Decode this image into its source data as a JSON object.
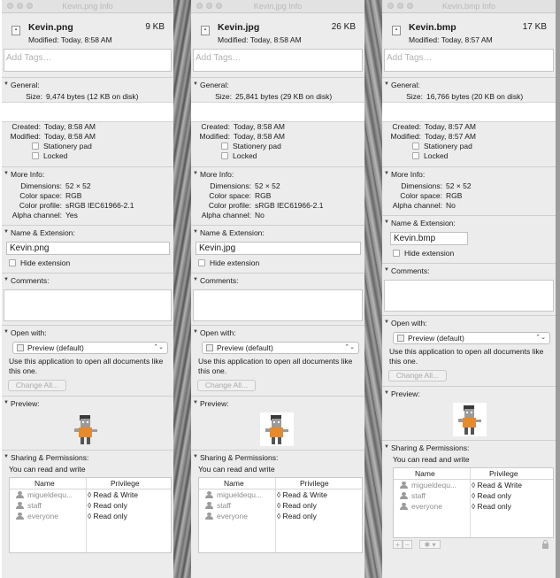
{
  "common": {
    "tags_placeholder": "Add Tags…",
    "sections": {
      "general": "General:",
      "more_info": "More Info:",
      "name_ext": "Name & Extension:",
      "comments": "Comments:",
      "open_with": "Open with:",
      "preview": "Preview:",
      "sharing": "Sharing & Permissions:"
    },
    "labels": {
      "size": "Size:",
      "created": "Created:",
      "modified": "Modified:",
      "stationery": "Stationery pad",
      "locked": "Locked",
      "dimensions": "Dimensions:",
      "color_space": "Color space:",
      "color_profile": "Color profile:",
      "alpha_channel": "Alpha channel:",
      "hide_extension": "Hide extension"
    },
    "open_with_app": "Preview (default)",
    "open_with_desc": "Use this application to open all documents like this one.",
    "change_all": "Change All...",
    "can_read_write": "You can read and write",
    "perm_headers": {
      "name": "Name",
      "privilege": "Privilege"
    },
    "perm_rows": [
      {
        "name": "migueldequ...",
        "privilege": "◊ Read & Write"
      },
      {
        "name": "staff",
        "privilege": "◊ Read only"
      },
      {
        "name": "everyone",
        "privilege": "◊ Read only"
      }
    ],
    "footer_buttons": {
      "add": "+",
      "remove": "−",
      "action": "✱ ▾"
    },
    "icons": {
      "file": "file-icon",
      "disclosure": "disclosure-triangle-icon",
      "app": "preview-app-icon",
      "user": "user-icon",
      "group": "group-icon",
      "lock": "lock-icon",
      "gear": "gear-icon"
    },
    "colors": {
      "window_bg": "#ececec",
      "desktop": "#7d7d7d"
    }
  },
  "windows": [
    {
      "title": "Kevin.png Info",
      "file_name": "Kevin.png",
      "file_size": "9 KB",
      "modified_line": "Modified: Today, 8:58 AM",
      "size_detail": "9,474 bytes (12 KB on disk)",
      "created": "Today, 8:58 AM",
      "modified": "Today, 8:58 AM",
      "dimensions": "52 × 52",
      "color_space": "RGB",
      "color_profile": "sRGB IEC61966-2.1",
      "alpha_channel": "Yes",
      "name_value": "Kevin.png",
      "preview_bg": "transparent"
    },
    {
      "title": "Kevin.jpg Info",
      "file_name": "Kevin.jpg",
      "file_size": "26 KB",
      "modified_line": "Modified: Today, 8:58 AM",
      "size_detail": "25,841 bytes (29 KB on disk)",
      "created": "Today, 8:58 AM",
      "modified": "Today, 8:58 AM",
      "dimensions": "52 × 52",
      "color_space": "RGB",
      "color_profile": "sRGB IEC61966-2.1",
      "alpha_channel": "No",
      "name_value": "Kevin.jpg",
      "preview_bg": "white"
    },
    {
      "title": "Kevin.bmp Info",
      "file_name": "Kevin.bmp",
      "file_size": "17 KB",
      "modified_line": "Modified: Today, 8:57 AM",
      "size_detail": "16,766 bytes (20 KB on disk)",
      "created": "Today, 8:57 AM",
      "modified": "Today, 8:57 AM",
      "dimensions": "52 × 52",
      "color_space": "RGB",
      "color_profile": "",
      "alpha_channel": "No",
      "name_value": "Kevin.bmp",
      "preview_bg": "white"
    }
  ]
}
